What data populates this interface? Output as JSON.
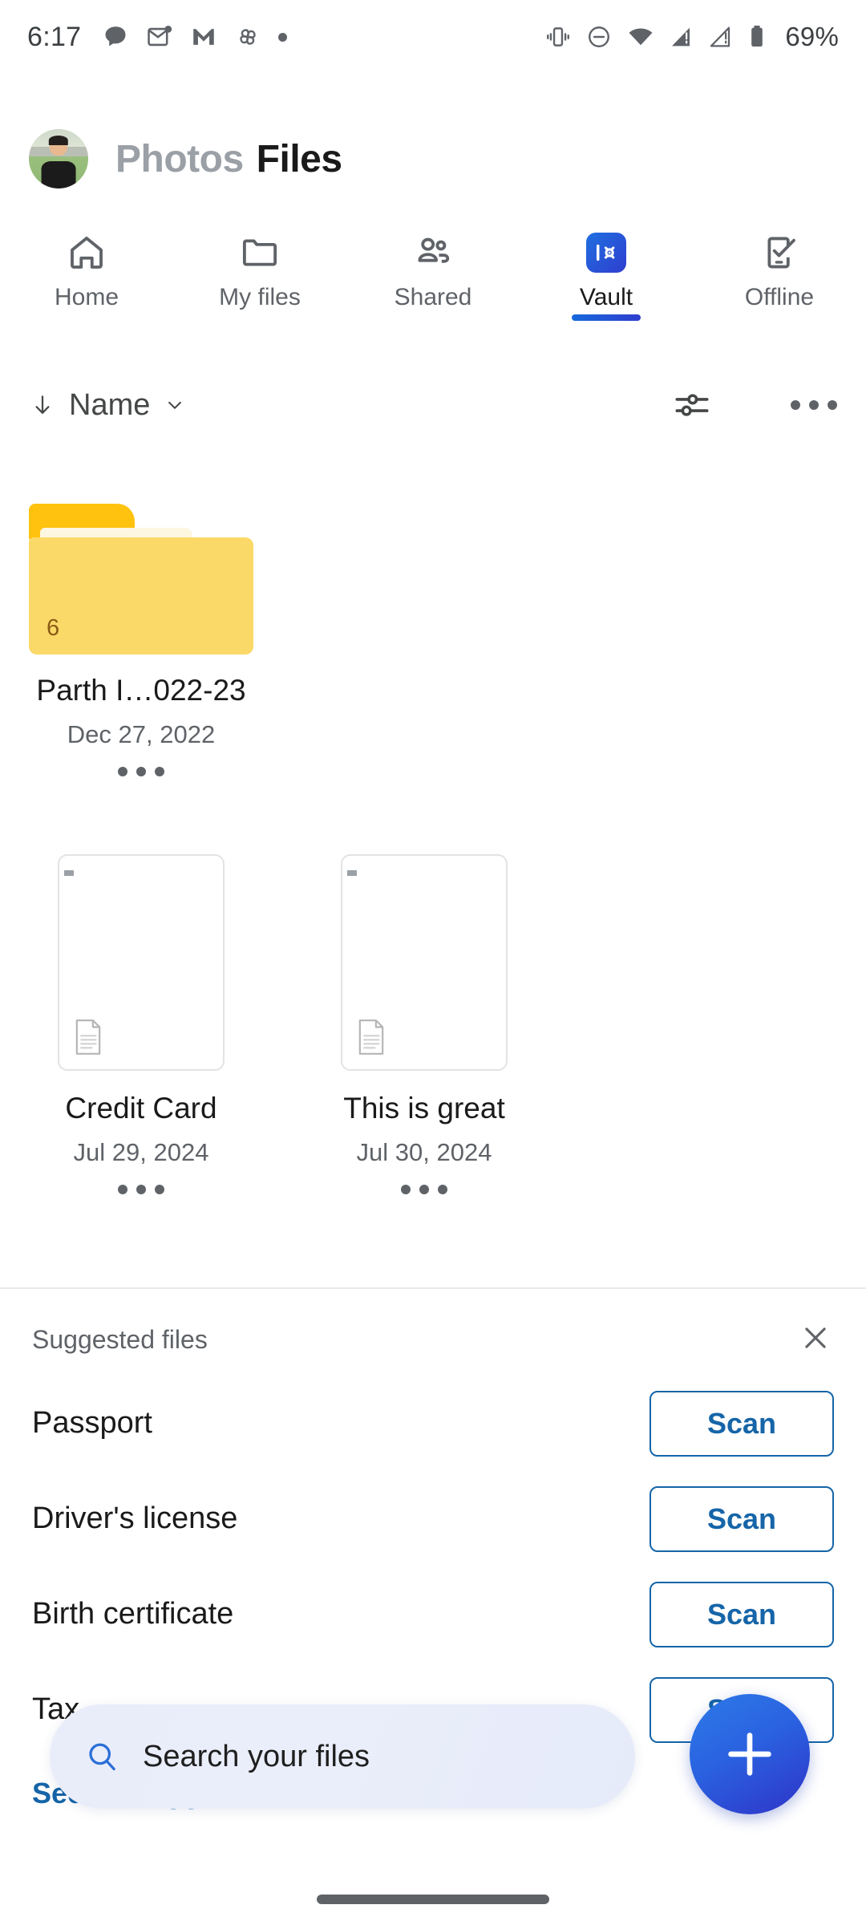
{
  "status_bar": {
    "time": "6:17",
    "battery_percent": "69%",
    "left_icons": [
      "chat-bubble-icon",
      "mail-unread-icon",
      "gmail-icon",
      "pinwheel-icon",
      "overflow-dot-icon"
    ],
    "right_icons": [
      "vibrate-icon",
      "do-not-disturb-icon",
      "wifi-icon",
      "signal-sim1-icon",
      "signal-sim2-icon",
      "battery-icon"
    ]
  },
  "header": {
    "avatar_name": "user-avatar",
    "app_name_muted": "Photos",
    "app_name_active": "Files"
  },
  "tabs": [
    {
      "label": "Home",
      "icon": "home-icon",
      "active": false
    },
    {
      "label": "My files",
      "icon": "folder-icon",
      "active": false
    },
    {
      "label": "Shared",
      "icon": "people-icon",
      "active": false
    },
    {
      "label": "Vault",
      "icon": "vault-icon",
      "active": true
    },
    {
      "label": "Offline",
      "icon": "phone-check-icon",
      "active": false
    }
  ],
  "sort_bar": {
    "sort_label": "Name",
    "sort_direction_icon": "arrow-down-icon",
    "chevron_icon": "chevron-down-icon",
    "filter_icon": "filter-sliders-icon",
    "more_icon": "more-horizontal-icon"
  },
  "items": [
    {
      "type": "folder",
      "name": "Parth I…022-23",
      "date": "Dec 27, 2022",
      "count": "6"
    },
    {
      "type": "file",
      "name": "Credit Card",
      "date": "Jul 29, 2024"
    },
    {
      "type": "file",
      "name": "This is great",
      "date": "Jul 30, 2024"
    }
  ],
  "suggested": {
    "title": "Suggested files",
    "close_icon": "close-icon",
    "rows": [
      {
        "label": "Passport",
        "button": "Scan"
      },
      {
        "label": "Driver's license",
        "button": "Scan"
      },
      {
        "label": "Birth certificate",
        "button": "Scan"
      },
      {
        "label": "Tax",
        "button": "Scan"
      }
    ],
    "see_all": "See all suggested"
  },
  "search": {
    "placeholder": "Search your files",
    "icon": "search-icon"
  },
  "fab": {
    "label": "add-button",
    "icon": "plus-icon"
  },
  "colors": {
    "accent_blue": "#1565a8",
    "vault_gradient_start": "#1f6fe0",
    "vault_gradient_end": "#2f3ecf",
    "folder_yellow": "#fbd968",
    "folder_tab_yellow": "#ffc20e",
    "muted_text": "#5f6368"
  }
}
